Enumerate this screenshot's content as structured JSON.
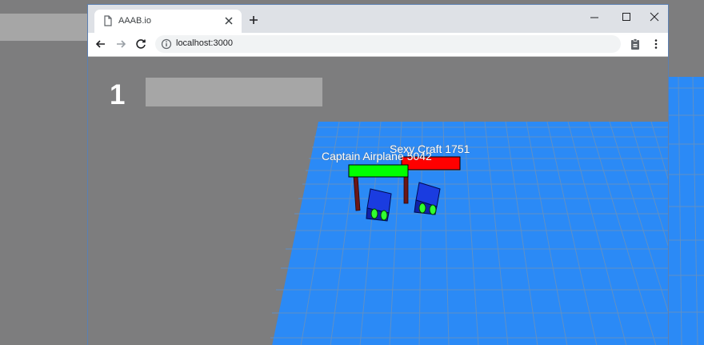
{
  "browser": {
    "tab_title": "AAAB.io",
    "url": "localhost:3000"
  },
  "icons": {
    "tab": "page-icon",
    "close": "close-icon",
    "new_tab": "plus-icon",
    "minimize": "minimize-icon",
    "maximize": "maximize-icon",
    "window_close": "close-icon",
    "back": "back-arrow-icon",
    "forward": "forward-arrow-icon",
    "reload": "reload-icon",
    "info": "info-icon",
    "clipboard": "clipboard-icon",
    "menu": "kebab-menu-icon"
  },
  "game": {
    "level": "1",
    "players": [
      {
        "name": "Captain Airplane",
        "score": "5042",
        "label": "Captain Airplane 5042",
        "health_color": "#00ff00"
      },
      {
        "name": "Sexy Craft",
        "score": "1751",
        "label": "Sexy Craft 1751",
        "health_color": "#ff0000"
      }
    ]
  },
  "colors": {
    "floor": "#2b8af6",
    "grid_line": "#5f90c6",
    "background": "#7d7d7e",
    "hud_bar": "#a6a6a6",
    "craft_body": "#1428c8",
    "craft_wheel": "#30ff30",
    "pole": "#6b1616"
  }
}
